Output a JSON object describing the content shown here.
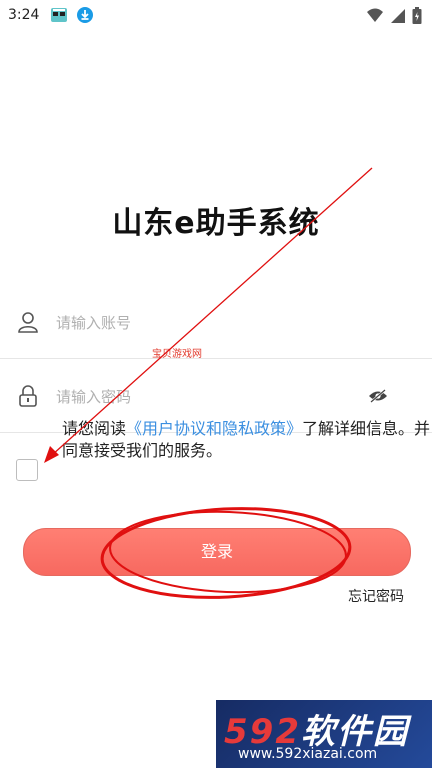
{
  "status_bar": {
    "time": "3:24",
    "icons": [
      "game-notification-icon",
      "download-icon",
      "wifi-icon",
      "signal-icon",
      "battery-icon"
    ]
  },
  "app": {
    "title": "山东e助手系统"
  },
  "form": {
    "account_placeholder": "请输入账号",
    "account_value": "",
    "password_placeholder": "请输入密码",
    "password_value": ""
  },
  "agreement": {
    "prefix": "请您阅读",
    "link": "《用户协议和隐私政策》",
    "suffix": "了解详细信息。并同意接受我们的服务。",
    "checked": false
  },
  "login_label": "登录",
  "forgot_label": "忘记密码",
  "watermarks": {
    "small": "宝贝游戏网",
    "corner_top_num": "592",
    "corner_top_text": "软件园",
    "corner_bottom": "www.592xiazai.com"
  },
  "colors": {
    "button": "#f76960",
    "link": "#3b8fe0",
    "annotation": "#e01010"
  }
}
